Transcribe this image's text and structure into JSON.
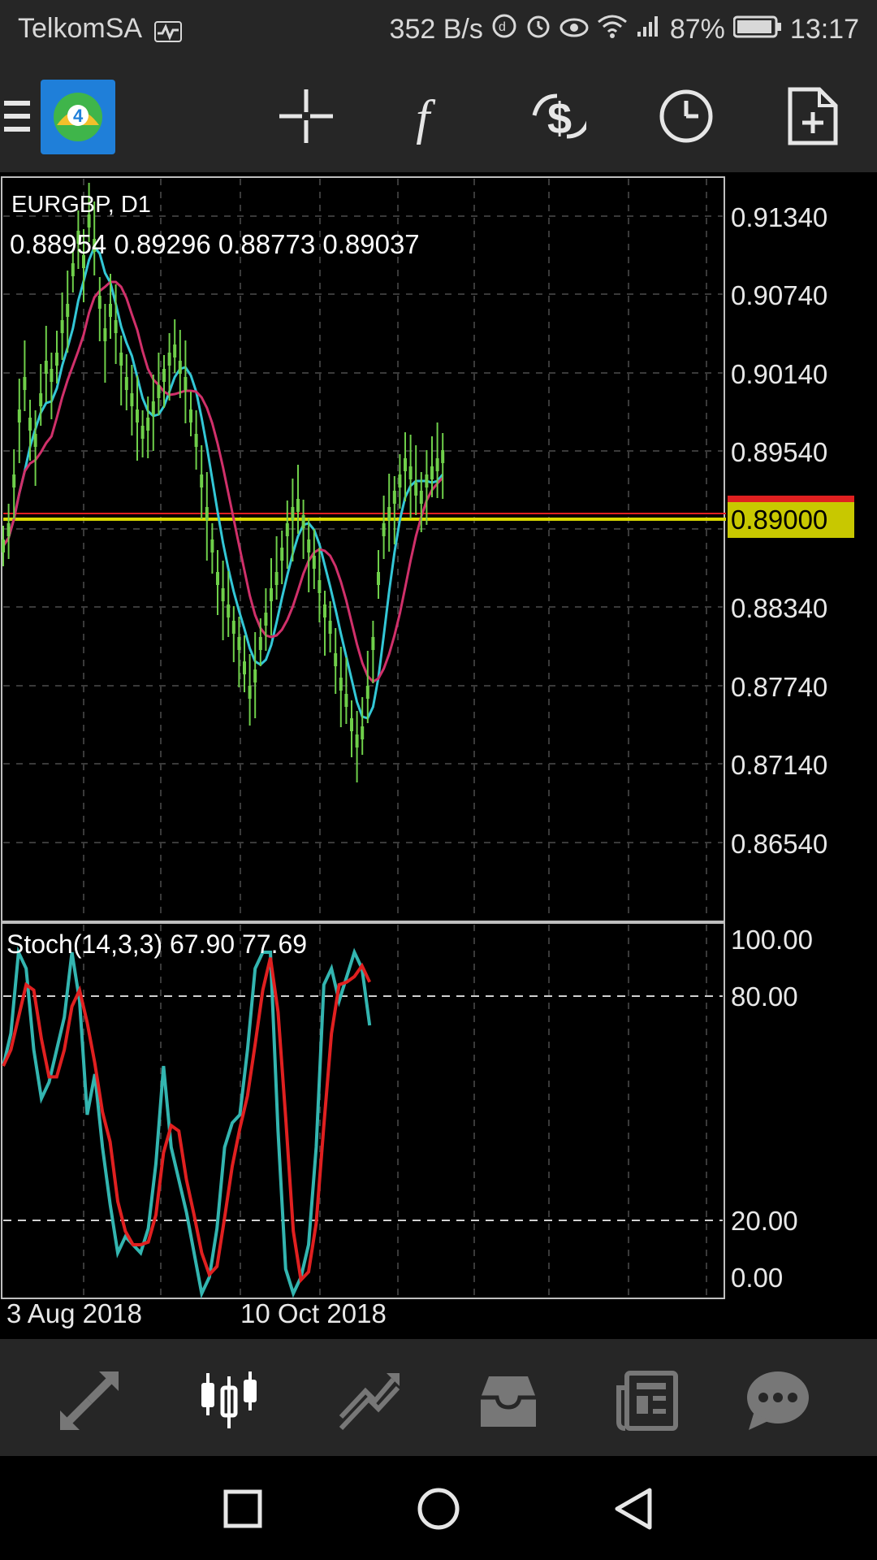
{
  "status_bar": {
    "carrier": "TelkomSA",
    "net_speed": "352 B/s",
    "battery": "87%",
    "time": "13:17"
  },
  "toolbar": {
    "icons": [
      "menu-icon",
      "mt4-app-logo",
      "crosshair-icon",
      "indicators-icon",
      "trade-icon",
      "timeframe-clock-icon",
      "new-order-icon"
    ]
  },
  "chart": {
    "symbol": "EURGBP, D1",
    "ohlc": "0.88954 0.89296 0.88773 0.89037",
    "price_scale": [
      "0.91340",
      "0.90740",
      "0.90140",
      "0.89540",
      "0.88340",
      "0.87740",
      "0.87140",
      "0.86540"
    ],
    "current_price": "0.89000",
    "colors": {
      "candles": "#6fcf4a",
      "ma_fast": "#33c7d6",
      "ma_slow": "#d0306a",
      "bid_line": "#d9d900",
      "ask_line": "#e02020",
      "stoch_main": "#33b5b0",
      "stoch_signal": "#e02020"
    },
    "date_labels": [
      "3 Aug 2018",
      "10 Oct 2018"
    ]
  },
  "stochastic": {
    "label": "Stoch(14,3,3) 67.90 77.69",
    "levels": [
      "100.00",
      "80.00",
      "20.00",
      "0.00"
    ]
  },
  "bottom_nav": {
    "items": [
      "quotes-icon",
      "chart-icon",
      "trade-icon",
      "history-icon",
      "news-icon",
      "messages-icon"
    ],
    "active": "chart-icon"
  }
}
